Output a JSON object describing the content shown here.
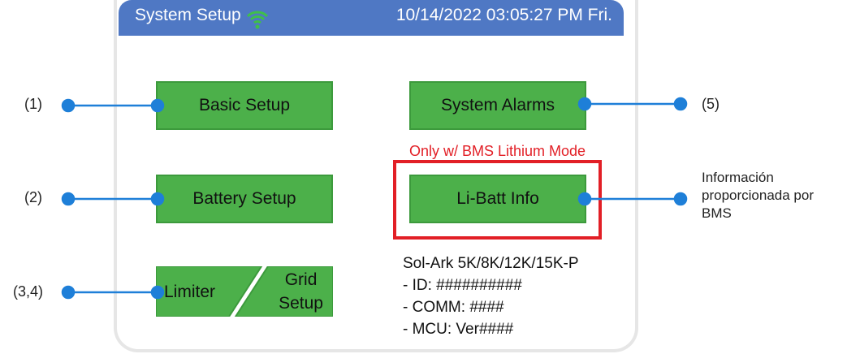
{
  "header": {
    "title": "System Setup",
    "datetime": "10/14/2022 03:05:27 PM Fri.",
    "wifi_icon": "wifi-icon"
  },
  "buttons": {
    "basic_setup": "Basic Setup",
    "battery_setup": "Battery Setup",
    "limiter": "Limiter",
    "grid_setup": "Grid\nSetup",
    "system_alarms": "System Alarms",
    "li_batt_info": "Li-Batt Info"
  },
  "bms_note": "Only w/ BMS Lithium Mode",
  "callouts": {
    "c1": "(1)",
    "c2": "(2)",
    "c34": "(3,4)",
    "c5": "(5)",
    "info": "Información\nproporcionada por\nBMS"
  },
  "device": {
    "model": "Sol-Ark 5K/8K/12K/15K-P",
    "id": "- ID: ##########",
    "comm": "- COMM: ####",
    "mcu": "- MCU: Ver####"
  },
  "colors": {
    "titlebar": "#4f78c4",
    "button": "#4cb04a",
    "callout": "#1e7fd8",
    "highlight": "#e21f26"
  }
}
